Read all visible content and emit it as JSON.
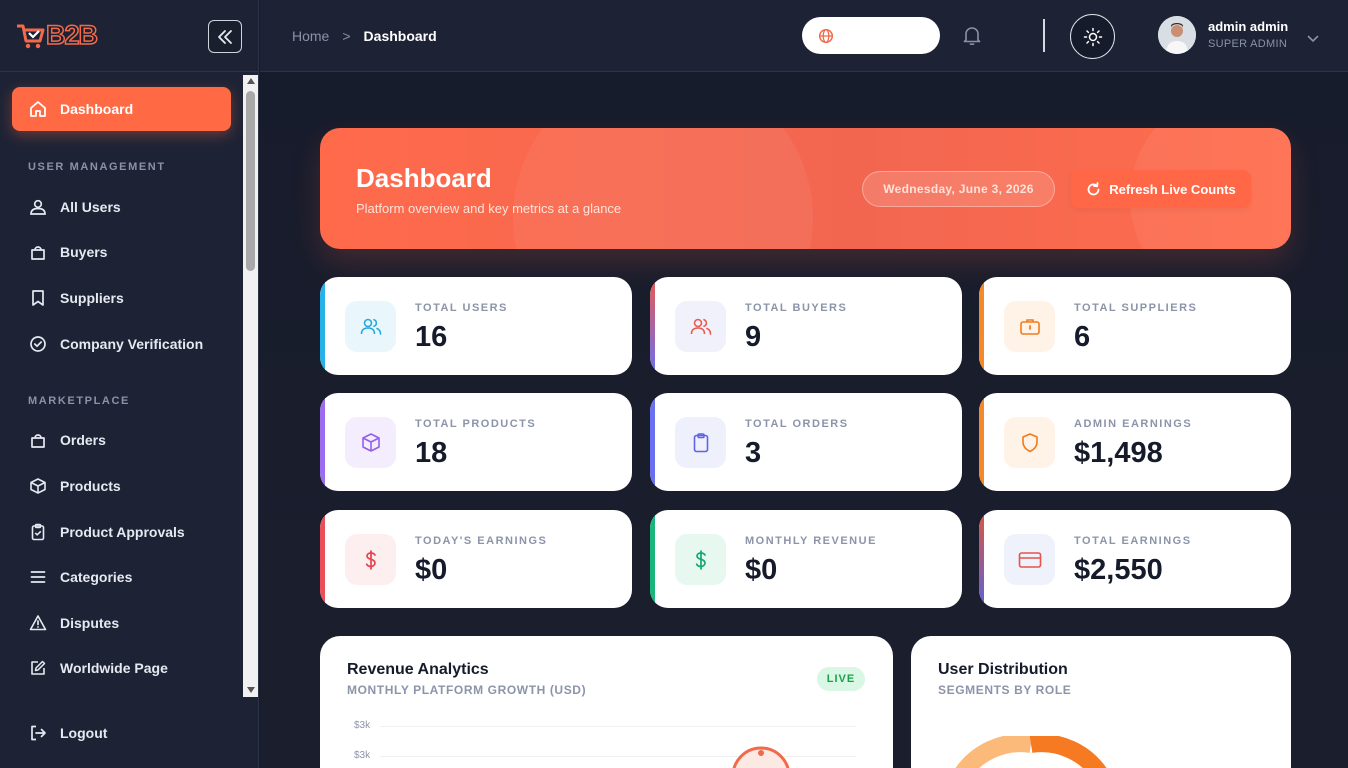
{
  "brand": {
    "logo_text": "B2B"
  },
  "sidebar": {
    "active": {
      "label": "Dashboard",
      "icon": "home-icon"
    },
    "sections": [
      {
        "title": "USER MANAGEMENT",
        "items": [
          {
            "label": "All Users",
            "icon": "users-icon"
          },
          {
            "label": "Buyers",
            "icon": "shopping-bag-icon"
          },
          {
            "label": "Suppliers",
            "icon": "bookmark-icon"
          },
          {
            "label": "Company Verification",
            "icon": "check-circle-icon"
          }
        ]
      },
      {
        "title": "MARKETPLACE",
        "items": [
          {
            "label": "Orders",
            "icon": "shopping-bag-icon"
          },
          {
            "label": "Products",
            "icon": "box-icon"
          },
          {
            "label": "Product Approvals",
            "icon": "clipboard-check-icon"
          },
          {
            "label": "Categories",
            "icon": "list-icon"
          },
          {
            "label": "Disputes",
            "icon": "alert-triangle-icon"
          },
          {
            "label": "Worldwide Page",
            "icon": "edit-icon"
          }
        ]
      }
    ],
    "logout": "Logout"
  },
  "header": {
    "breadcrumb": {
      "home": "Home",
      "separator": ">",
      "current": "Dashboard"
    },
    "user": {
      "name": "admin admin",
      "role": "SUPER ADMIN"
    }
  },
  "hero": {
    "title": "Dashboard",
    "subtitle": "Platform overview and key metrics at a glance",
    "date": "Wednesday, June 3, 2026",
    "refresh_label": "Refresh Live Counts"
  },
  "stats": [
    {
      "label": "TOTAL USERS",
      "value": "16",
      "accent": "#28b1e8",
      "icon": "users-icon"
    },
    {
      "label": "TOTAL BUYERS",
      "value": "9",
      "accent": "#e85a4f",
      "icon": "users-icon"
    },
    {
      "label": "TOTAL SUPPLIERS",
      "value": "6",
      "accent": "#f5892a",
      "icon": "briefcase-icon"
    },
    {
      "label": "TOTAL PRODUCTS",
      "value": "18",
      "accent": "#9b6bf0",
      "icon": "box-icon"
    },
    {
      "label": "TOTAL ORDERS",
      "value": "3",
      "accent": "#6a6ff0",
      "icon": "clipboard-icon"
    },
    {
      "label": "ADMIN EARNINGS",
      "value": "$1,498",
      "accent": "#f5892a",
      "icon": "shield-icon"
    },
    {
      "label": "TODAY'S EARNINGS",
      "value": "$0",
      "accent": "#ea4f59",
      "icon": "dollar-icon"
    },
    {
      "label": "MONTHLY REVENUE",
      "value": "$0",
      "accent": "#19b57a",
      "icon": "dollar-icon"
    },
    {
      "label": "TOTAL EARNINGS",
      "value": "$2,550",
      "accent": "#e0553f",
      "icon": "credit-card-icon"
    }
  ],
  "revenue_panel": {
    "title": "Revenue Analytics",
    "subtitle": "MONTHLY PLATFORM GROWTH (USD)",
    "badge": "LIVE",
    "y_ticks": [
      "$3k",
      "$3k"
    ]
  },
  "distribution_panel": {
    "title": "User Distribution",
    "subtitle": "SEGMENTS BY ROLE"
  },
  "colors": {
    "accent": "#ff6a45",
    "sidebar_bg": "#1d2335",
    "main_bg": "#161b2b"
  }
}
